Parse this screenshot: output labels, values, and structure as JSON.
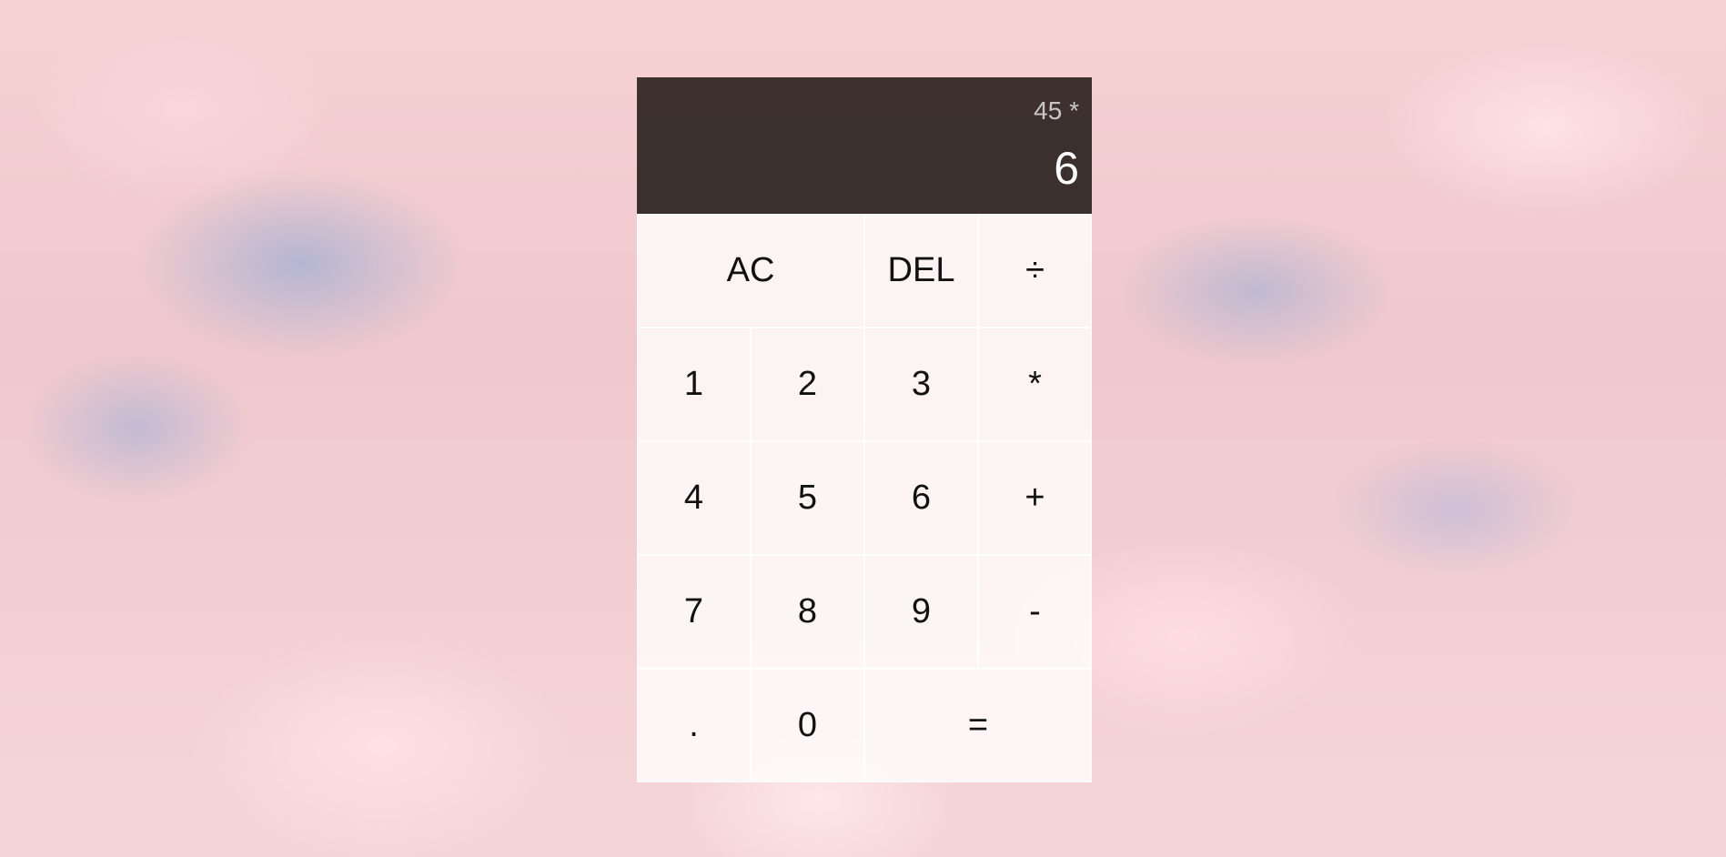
{
  "display": {
    "previous_operand": "45 *",
    "current_operand": "6"
  },
  "buttons": {
    "all_clear": "AC",
    "delete": "DEL",
    "divide": "÷",
    "one": "1",
    "two": "2",
    "three": "3",
    "multiply": "*",
    "four": "4",
    "five": "5",
    "six": "6",
    "add": "+",
    "seven": "7",
    "eight": "8",
    "nine": "9",
    "subtract": "-",
    "decimal": ".",
    "zero": "0",
    "equals": "="
  },
  "colors": {
    "display_background": "#2d2321",
    "button_background": "#ffffffc7",
    "background_tint": "#f3cfd3"
  }
}
